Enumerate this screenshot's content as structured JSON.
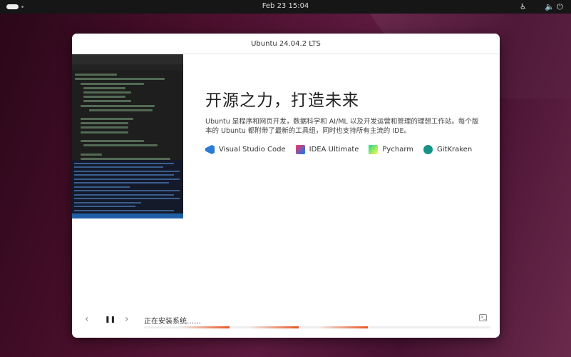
{
  "topbar": {
    "clock": "Feb 23  15:04",
    "icons": [
      "accessibility-icon",
      "volume-icon",
      "power-icon"
    ]
  },
  "window": {
    "title": "Ubuntu 24.04.2 LTS",
    "heading": "开源之力，打造未来",
    "description": "Ubuntu 是程序和网页开发，数据科学和 AI/ML 以及开发运营和管理的理想工作站。每个版本的 Ubuntu 都附带了最新的工具组，同时也支持所有主流的 IDE。",
    "apps": [
      {
        "label": "Visual Studio Code",
        "icon": "vscode-icon",
        "color": "#2a7bd3"
      },
      {
        "label": "IDEA Ultimate",
        "icon": "intellij-icon",
        "color": "#c0265a"
      },
      {
        "label": "Pycharm",
        "icon": "pycharm-icon",
        "color": "#21d789"
      },
      {
        "label": "GitKraken",
        "icon": "gitkraken-icon",
        "color": "#179287"
      }
    ],
    "status": "正在安装系统……",
    "accent": "#e95420"
  }
}
